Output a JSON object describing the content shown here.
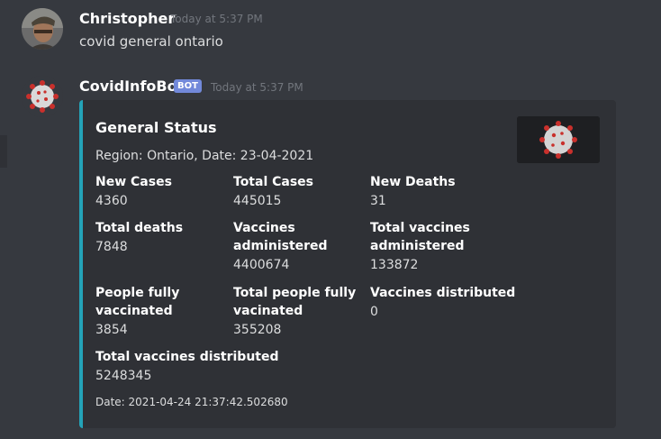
{
  "messages": [
    {
      "username": "Christopher",
      "timestamp": "Today at 5:37 PM",
      "content": "covid general ontario",
      "avatar_icon": "user-avatar"
    },
    {
      "username": "CovidInfoBot",
      "badge": "BOT",
      "timestamp": "Today at 5:37 PM",
      "avatar_icon": "virus-avatar",
      "embed": {
        "accent_color": "#24a3b8",
        "title": "General Status",
        "description": "Region: Ontario, Date: 23-04-2021",
        "thumbnail_icon": "virus-image",
        "fields": [
          {
            "name": "New Cases",
            "value": "4360"
          },
          {
            "name": "Total Cases",
            "value": "445015"
          },
          {
            "name": "New Deaths",
            "value": "31"
          },
          {
            "name": "Total deaths",
            "value": "7848"
          },
          {
            "name": "Vaccines administered",
            "value": "4400674"
          },
          {
            "name": "Total vaccines administered",
            "value": "133872"
          },
          {
            "name": "People fully vaccinated",
            "value": "3854"
          },
          {
            "name": "Total people fully vacinated",
            "value": "355208"
          },
          {
            "name": "Vaccines distributed",
            "value": "0"
          },
          {
            "name": "Total vaccines distributed",
            "value": "5248345"
          }
        ],
        "footer": "Date: 2021-04-24 21:37:42.502680"
      }
    }
  ],
  "colors": {
    "background": "#36393f",
    "embed_background": "#2f3136",
    "badge": "#7289da"
  }
}
